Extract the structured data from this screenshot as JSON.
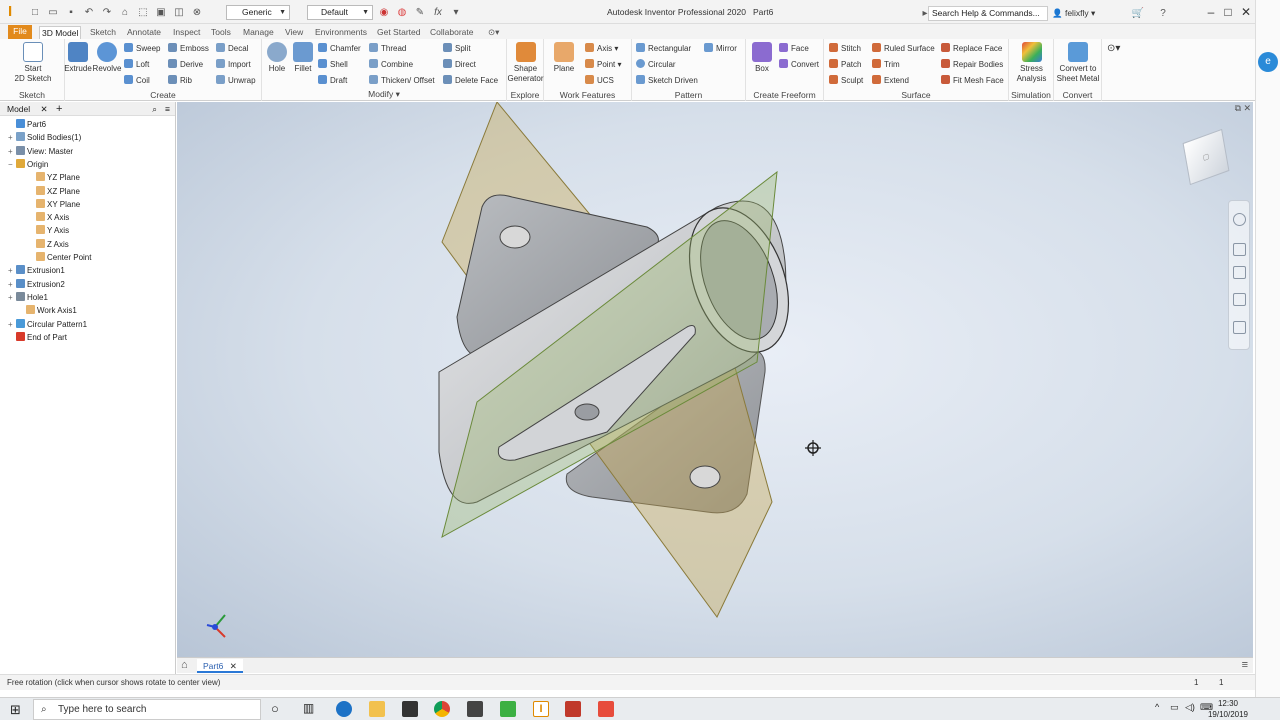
{
  "window": {
    "title": "Autodesk Inventor Professional 2020",
    "document": "Part6",
    "search_placeholder": "Search Help & Commands...",
    "user": "felixfly",
    "style_combo": "Generic",
    "appearance_combo": "Default"
  },
  "ribbon_tabs": [
    "File",
    "3D Model",
    "Sketch",
    "Annotate",
    "Inspect",
    "Tools",
    "Manage",
    "View",
    "Environments",
    "Get Started",
    "Collaborate"
  ],
  "panels": {
    "sketch": {
      "title": "Sketch",
      "start_2d_sketch_line1": "Start",
      "start_2d_sketch_line2": "2D Sketch"
    },
    "create": {
      "title": "Create",
      "extrude": "Extrude",
      "revolve": "Revolve",
      "sweep": "Sweep",
      "emboss": "Emboss",
      "decal": "Decal",
      "loft": "Loft",
      "derive": "Derive",
      "import": "Import",
      "coil": "Coil",
      "rib": "Rib",
      "unwrap": "Unwrap"
    },
    "modify": {
      "title": "Modify",
      "hole": "Hole",
      "fillet": "Fillet",
      "chamfer": "Chamfer",
      "thread": "Thread",
      "split": "Split",
      "shell": "Shell",
      "combine": "Combine",
      "direct": "Direct",
      "draft": "Draft",
      "thicken_offset": "Thicken/ Offset",
      "delete_face": "Delete Face"
    },
    "explore": {
      "title": "Explore",
      "shape_generator_line1": "Shape",
      "shape_generator_line2": "Generator"
    },
    "work_features": {
      "title": "Work Features",
      "plane": "Plane",
      "axis": "Axis",
      "point": "Point",
      "ucs": "UCS"
    },
    "pattern": {
      "title": "Pattern",
      "rectangular": "Rectangular",
      "mirror": "Mirror",
      "circular": "Circular",
      "sketch_driven": "Sketch Driven"
    },
    "create_freeform": {
      "title": "Create Freeform",
      "box": "Box",
      "face": "Face",
      "convert": "Convert"
    },
    "surface": {
      "title": "Surface",
      "stitch": "Stitch",
      "ruled_surface": "Ruled Surface",
      "replace_face": "Replace Face",
      "patch": "Patch",
      "trim": "Trim",
      "repair_bodies": "Repair Bodies",
      "sculpt": "Sculpt",
      "extend": "Extend",
      "fit_mesh_face": "Fit Mesh Face"
    },
    "simulation": {
      "title": "Simulation",
      "stress_line1": "Stress",
      "stress_line2": "Analysis"
    },
    "convert": {
      "title": "Convert",
      "sheet_line1": "Convert to",
      "sheet_line2": "Sheet Metal"
    }
  },
  "browser": {
    "tab": "Model",
    "nodes": [
      {
        "label": "Part6",
        "icon_color": "#4a8fd8"
      },
      {
        "label": "Solid Bodies(1)",
        "icon_color": "#7aa1c8"
      },
      {
        "label": "View: Master",
        "icon_color": "#7a8fa8"
      },
      {
        "label": "Origin",
        "icon_color": "#e0a93a"
      },
      {
        "label": "YZ Plane",
        "icon_color": "#e6b46e"
      },
      {
        "label": "XZ Plane",
        "icon_color": "#e6b46e"
      },
      {
        "label": "XY Plane",
        "icon_color": "#e6b46e"
      },
      {
        "label": "X Axis",
        "icon_color": "#e6b46e"
      },
      {
        "label": "Y Axis",
        "icon_color": "#e6b46e"
      },
      {
        "label": "Z Axis",
        "icon_color": "#e6b46e"
      },
      {
        "label": "Center Point",
        "icon_color": "#e6b46e"
      },
      {
        "label": "Extrusion1",
        "icon_color": "#5a8fc8"
      },
      {
        "label": "Extrusion2",
        "icon_color": "#5a8fc8"
      },
      {
        "label": "Hole1",
        "icon_color": "#7a8a9a"
      },
      {
        "label": "Work Axis1",
        "icon_color": "#e6b46e"
      },
      {
        "label": "Circular Pattern1",
        "icon_color": "#4a9ad8"
      },
      {
        "label": "End of Part",
        "icon_color": "#d83a2a"
      }
    ]
  },
  "doc_tab": "Part6",
  "status": {
    "message": "Free rotation (click when cursor shows rotate to center view)",
    "count1": "1",
    "count2": "1"
  },
  "taskbar": {
    "search_placeholder": "Type here to search",
    "time": "12:30",
    "date": "19/10/2019"
  },
  "colors": {
    "file_tab": "#e28a1c",
    "plane_yellow": "#c9a64a",
    "plane_green": "#9bb86a",
    "body_grey": "#c7c9cc"
  }
}
